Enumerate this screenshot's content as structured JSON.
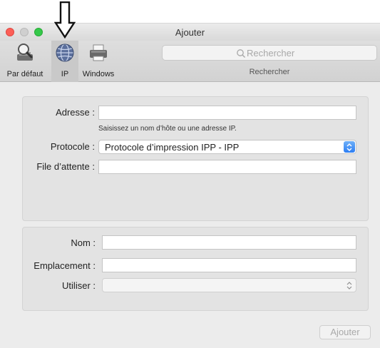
{
  "window": {
    "title": "Ajouter"
  },
  "toolbar": {
    "items": [
      {
        "label": "Par défaut",
        "icon": "magnifier-printer-icon"
      },
      {
        "label": "IP",
        "icon": "globe-icon",
        "selected": true
      },
      {
        "label": "Windows",
        "icon": "printer-icon"
      }
    ],
    "search": {
      "placeholder": "Rechercher",
      "caption": "Rechercher"
    }
  },
  "form": {
    "address_label": "Adresse :",
    "address_value": "",
    "address_hint": "Saisissez un nom d’hôte ou une adresse IP.",
    "protocol_label": "Protocole :",
    "protocol_value": "Protocole d’impression IPP - IPP",
    "queue_label": "File d’attente :",
    "queue_value": "",
    "name_label": "Nom :",
    "name_value": "",
    "location_label": "Emplacement :",
    "location_value": "",
    "use_label": "Utiliser :",
    "use_value": ""
  },
  "actions": {
    "add_label": "Ajouter"
  },
  "colors": {
    "accent": "#2d7ef3",
    "close": "#fc5f57",
    "maximize": "#35c84a"
  }
}
